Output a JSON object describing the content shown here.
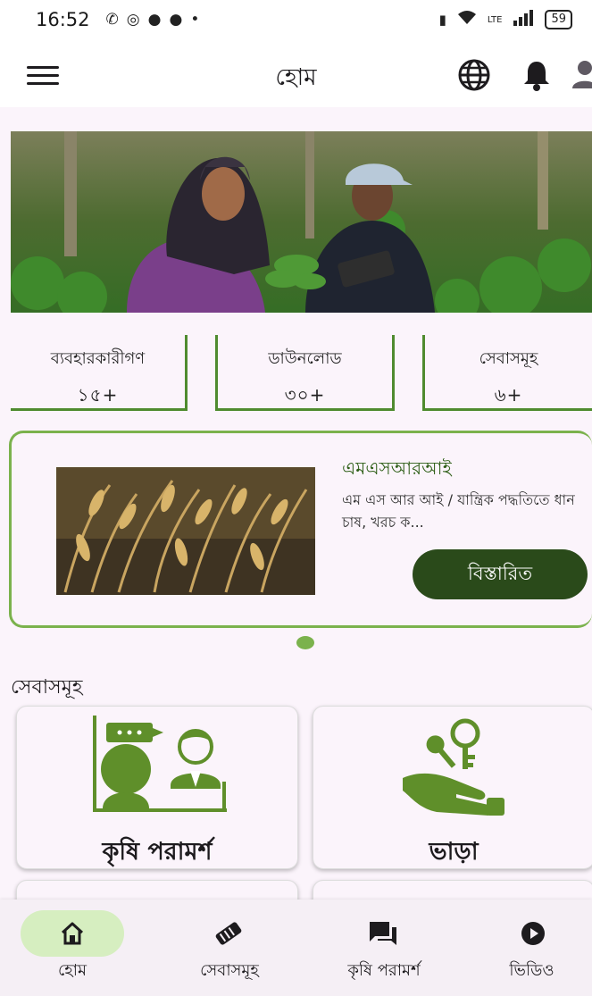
{
  "status_bar": {
    "time": "16:52",
    "battery": "59",
    "network": "LTE"
  },
  "app_bar": {
    "title": "হোম"
  },
  "stats": [
    {
      "label": "ব্যবহারকারীগণ",
      "value": "১৫+"
    },
    {
      "label": "ডাউনলোড",
      "value": "৩০+"
    },
    {
      "label": "সেবাসমূহ",
      "value": "৬+"
    }
  ],
  "promo": {
    "title": "এমএসআরআই",
    "text": "এম এস আর আই / যান্ত্রিক পদ্ধতিতে ধান চাষ, খরচ ক...",
    "button": "বিস্তারিত"
  },
  "services": {
    "section_title": "সেবাসমূহ",
    "items": [
      {
        "label": "কৃষি পরামর্শ",
        "icon": "consultation-icon"
      },
      {
        "label": "ভাড়া",
        "icon": "rent-key-icon"
      }
    ]
  },
  "bottom_nav": [
    {
      "label": "হোম",
      "icon": "home-icon",
      "active": true
    },
    {
      "label": "সেবাসমূহ",
      "icon": "services-icon",
      "active": false
    },
    {
      "label": "কৃষি পরামর্শ",
      "icon": "chat-icon",
      "active": false
    },
    {
      "label": "ভিডিও",
      "icon": "play-icon",
      "active": false
    }
  ],
  "colors": {
    "accent_green": "#4f8b2f",
    "dark_green": "#2a4a1a",
    "nav_pill": "#d6eec0",
    "background": "#fbf4fb"
  }
}
